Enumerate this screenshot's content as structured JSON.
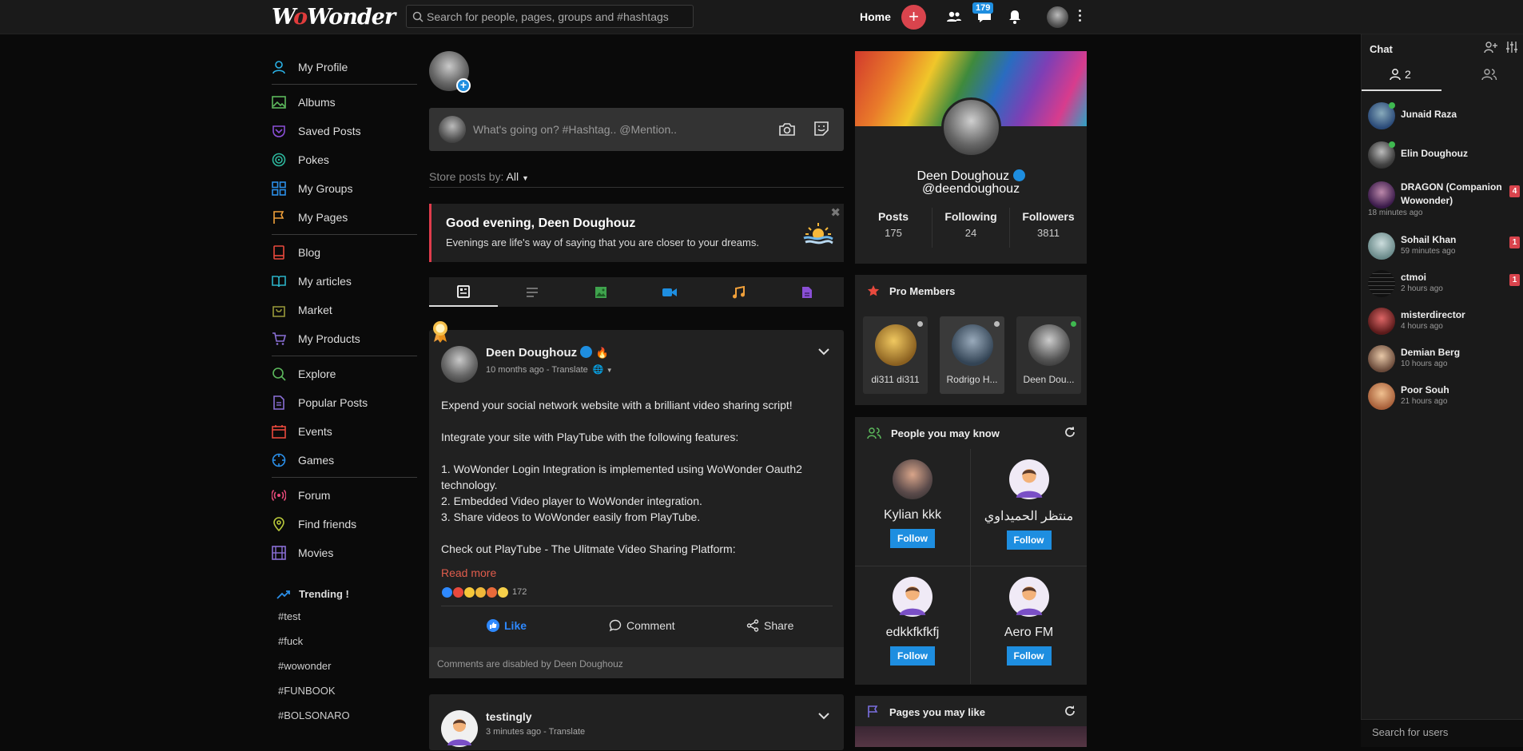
{
  "header": {
    "logo": "WoWonder",
    "search_placeholder": "Search for people, pages, groups and #hashtags",
    "home_label": "Home",
    "messages_count": "179"
  },
  "sidebar": {
    "items": [
      {
        "label": "My Profile"
      },
      {
        "label": "Albums"
      },
      {
        "label": "Saved Posts"
      },
      {
        "label": "Pokes"
      },
      {
        "label": "My Groups"
      },
      {
        "label": "My Pages"
      },
      {
        "label": "Blog"
      },
      {
        "label": "My articles"
      },
      {
        "label": "Market"
      },
      {
        "label": "My Products"
      },
      {
        "label": "Explore"
      },
      {
        "label": "Popular Posts"
      },
      {
        "label": "Events"
      },
      {
        "label": "Games"
      },
      {
        "label": "Forum"
      },
      {
        "label": "Find friends"
      },
      {
        "label": "Movies"
      }
    ],
    "trending_title": "Trending !",
    "tags": [
      "#test",
      "#fuck",
      "#wowonder",
      "#FUNBOOK",
      "#BOLSONARO"
    ]
  },
  "feed": {
    "composer_placeholder": "What's going on? #Hashtag.. @Mention..",
    "store_label": "Store posts by:",
    "store_value": "All",
    "greeting_title": "Good evening, Deen Doughouz",
    "greeting_text": "Evenings are life's way of saying that you are closer to your dreams.",
    "post": {
      "author": "Deen Doughouz",
      "meta": "10 months ago - Translate",
      "body": [
        "Expend your social network website with a brilliant video sharing script!",
        "",
        "Integrate your site with PlayTube with the following features:",
        "",
        "1. WoWonder Login Integration is implemented using WoWonder Oauth2 technology.",
        "2. Embedded Video player to WoWonder integration.",
        "3. Share videos to WoWonder easily from PlayTube.",
        "",
        "Check out PlayTube - The Ulitmate Video Sharing Platform:"
      ],
      "read_more": "Read more",
      "reactions_count": "172",
      "like": "Like",
      "comment": "Comment",
      "share": "Share",
      "comments_disabled": "Comments are disabled by Deen Doughouz"
    },
    "post2": {
      "author": "testingly",
      "meta": "3 minutes ago - Translate"
    }
  },
  "profile_card": {
    "name": "Deen Doughouz",
    "handle": "@deendoughouz",
    "stats": [
      {
        "label": "Posts",
        "value": "175"
      },
      {
        "label": "Following",
        "value": "24"
      },
      {
        "label": "Followers",
        "value": "3811"
      }
    ]
  },
  "pro_members": {
    "title": "Pro Members",
    "members": [
      {
        "name": "di311 di311",
        "status_color": "#bbbbbb",
        "avatar_color": "#b8902f"
      },
      {
        "name": "Rodrigo H...",
        "status_color": "#bbbbbb",
        "avatar_color": "#445566"
      },
      {
        "name": "Deen Dou...",
        "status_color": "#3fb950",
        "avatar_color": "#777777"
      }
    ]
  },
  "people": {
    "title": "People you may know",
    "follow_label": "Follow",
    "list": [
      {
        "name": "Kylian kkk"
      },
      {
        "name": "منتظر الحميداوي"
      },
      {
        "name": "edkkfkfkfj"
      },
      {
        "name": "Aero FM"
      }
    ]
  },
  "pages_like": {
    "title": "Pages you may like"
  },
  "chat": {
    "title": "Chat",
    "online_count": "2",
    "users": [
      {
        "name": "Junaid Raza",
        "time": "",
        "badge": "",
        "online": true,
        "color": "#4a7aa8"
      },
      {
        "name": "Elin Doughouz",
        "time": "",
        "badge": "",
        "online": true,
        "color": "#555555"
      },
      {
        "name": "DRAGON (Companion Wowonder)",
        "time": "18 minutes ago",
        "badge": "4",
        "online": false,
        "color": "#6a3a7a"
      },
      {
        "name": "Sohail Khan",
        "time": "59 minutes ago",
        "badge": "1",
        "online": false,
        "color": "#7fa5a5"
      },
      {
        "name": "ctmoi",
        "time": "2 hours ago",
        "badge": "1",
        "online": false,
        "color": "#111111"
      },
      {
        "name": "misterdirector",
        "time": "4 hours ago",
        "badge": "",
        "online": false,
        "color": "#8a2a2a"
      },
      {
        "name": "Demian Berg",
        "time": "10 hours ago",
        "badge": "",
        "online": false,
        "color": "#a87a5a"
      },
      {
        "name": "Poor Souh",
        "time": "21 hours ago",
        "badge": "",
        "online": false,
        "color": "#c88a4a"
      }
    ],
    "search_placeholder": "Search for users"
  }
}
